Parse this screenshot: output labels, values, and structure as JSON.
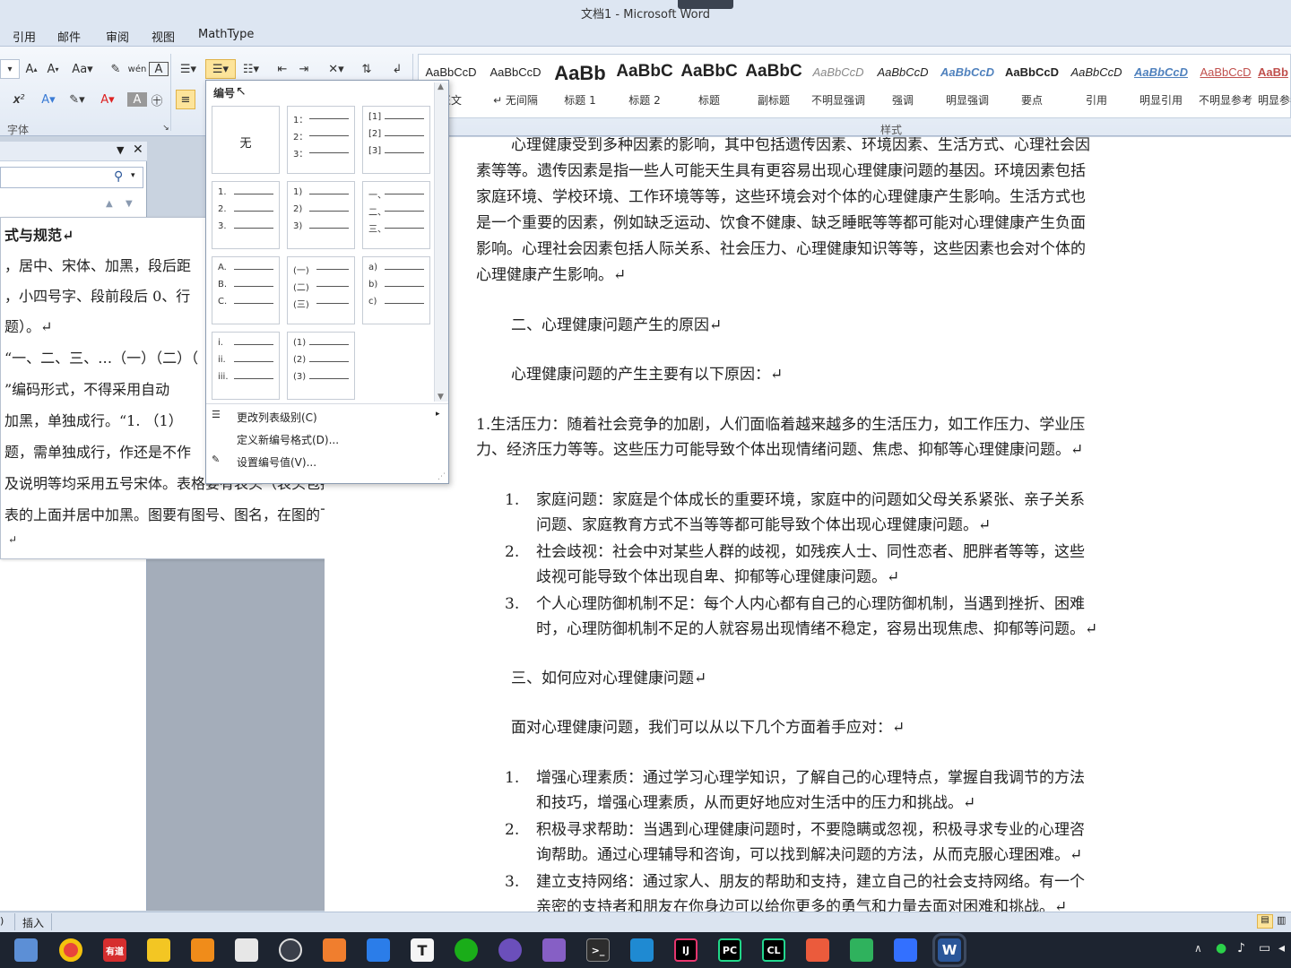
{
  "window": {
    "title": "文档1 - Microsoft Word"
  },
  "ribbon_tabs": [
    "引用",
    "邮件",
    "审阅",
    "视图",
    "MathType"
  ],
  "ribbon_groups": {
    "font": "字体",
    "styles": "样式"
  },
  "styles": [
    {
      "sample": "AaBbCcD",
      "name": "正文"
    },
    {
      "sample": "AaBbCcD",
      "name": "↵ 无间隔"
    },
    {
      "sample": "AaBb",
      "name": "标题 1"
    },
    {
      "sample": "AaBbC",
      "name": "标题 2"
    },
    {
      "sample": "AaBbC",
      "name": "标题"
    },
    {
      "sample": "AaBbC",
      "name": "副标题"
    },
    {
      "sample": "AaBbCcD",
      "name": "不明显强调"
    },
    {
      "sample": "AaBbCcD",
      "name": "强调"
    },
    {
      "sample": "AaBbCcD",
      "name": "明显强调"
    },
    {
      "sample": "AaBbCcD",
      "name": "要点"
    },
    {
      "sample": "AaBbCcD",
      "name": "引用"
    },
    {
      "sample": "AaBbCcD",
      "name": "明显引用"
    },
    {
      "sample": "AaBbCcD",
      "name": "不明显参考"
    },
    {
      "sample": "AaBb",
      "name": "明显参考"
    }
  ],
  "numbering_menu": {
    "title": "编号",
    "none_label": "无",
    "formats": [
      [
        "1：",
        "2：",
        "3："
      ],
      [
        "[1]",
        "[2]",
        "[3]"
      ],
      [
        "1.",
        "2.",
        "3."
      ],
      [
        "1)",
        "2)",
        "3)"
      ],
      [
        "一、",
        "二、",
        "三、"
      ],
      [
        "A.",
        "B.",
        "C."
      ],
      [
        "(一)",
        "(二)",
        "(三)"
      ],
      [
        "a)",
        "b)",
        "c)"
      ],
      [
        "i.",
        "ii.",
        "iii."
      ],
      [
        "(1)",
        "(2)",
        "(3)"
      ]
    ],
    "items": [
      "更改列表级别(C)",
      "定义新编号格式(D)...",
      "设置编号值(V)..."
    ]
  },
  "side_doc": {
    "lines": [
      "式与规范↵",
      "，居中、宋体、加黑，段后距",
      "，小四号字、段前段后 0、行",
      "题）。↵",
      "“一、二、三、…（一）（二）（",
      "”编码形式，不得采用自动",
      "加黑，单独成行。“1. （1）",
      "题，需单独成行，作还是不作",
      "及说明等均采用五号宋体。表格要有表头（表头包括",
      "表的上面并居中加黑。图要有图号、图名，在图的下",
      "↵"
    ]
  },
  "document": {
    "para1": [
      "心理健康受到多种因素的影响，其中包括遗传因素、环境因素、生活方式、心理社会因",
      "素等等。遗传因素是指一些人可能天生具有更容易出现心理健康问题的基因。环境因素包括",
      "家庭环境、学校环境、工作环境等等，这些环境会对个体的心理健康产生影响。生活方式也",
      "是一个重要的因素，例如缺乏运动、饮食不健康、缺乏睡眠等等都可能对心理健康产生负面",
      "影响。心理社会因素包括人际关系、社会压力、心理健康知识等等，这些因素也会对个体的",
      "心理健康产生影响。↵"
    ],
    "heading2": "二、心理健康问题产生的原因↵",
    "intro2": "心理健康问题的产生主要有以下原因：↵",
    "item1": [
      "1.生活压力：随着社会竞争的加剧，人们面临着越来越多的生活压力，如工作压力、学业压",
      "力、经济压力等等。这些压力可能导致个体出现情绪问题、焦虑、抑郁等心理健康问题。↵"
    ],
    "list1": [
      {
        "num": "1.",
        "lines": [
          "家庭问题：家庭是个体成长的重要环境，家庭中的问题如父母关系紧张、亲子关系",
          "问题、家庭教育方式不当等等都可能导致个体出现心理健康问题。↵"
        ]
      },
      {
        "num": "2.",
        "lines": [
          "社会歧视：社会中对某些人群的歧视，如残疾人士、同性恋者、肥胖者等等，这些",
          "歧视可能导致个体出现自卑、抑郁等心理健康问题。↵"
        ]
      },
      {
        "num": "3.",
        "lines": [
          "个人心理防御机制不足：每个人内心都有自己的心理防御机制，当遇到挫折、困难",
          "时，心理防御机制不足的人就容易出现情绪不稳定，容易出现焦虑、抑郁等问题。↵"
        ]
      }
    ],
    "heading3": "三、如何应对心理健康问题↵",
    "intro3": "面对心理健康问题，我们可以从以下几个方面着手应对：↵",
    "list2": [
      {
        "num": "1.",
        "lines": [
          "增强心理素质：通过学习心理学知识，了解自己的心理特点，掌握自我调节的方法",
          "和技巧，增强心理素质，从而更好地应对生活中的压力和挑战。↵"
        ]
      },
      {
        "num": "2.",
        "lines": [
          "积极寻求帮助：当遇到心理健康问题时，不要隐瞒或忽视，积极寻求专业的心理咨",
          "询帮助。通过心理辅导和咨询，可以找到解决问题的方法，从而克服心理困难。↵"
        ]
      },
      {
        "num": "3.",
        "lines": [
          "建立支持网络：通过家人、朋友的帮助和支持，建立自己的社会支持网络。有一个",
          "亲密的支持者和朋友在你身边可以给你更多的勇气和力量去面对困难和挑战。↵"
        ]
      }
    ]
  },
  "statusbar": {
    "mode": "插入"
  },
  "taskbar": {
    "apps": [
      {
        "icon": "file-explorer-icon",
        "label": "",
        "color": "#5c8fd6"
      },
      {
        "icon": "chrome-icon",
        "label": "",
        "color": "#e8453c"
      },
      {
        "icon": "youdao-icon",
        "label": "有道",
        "color": "#d62e2e"
      },
      {
        "icon": "sticky-notes-icon",
        "label": "",
        "color": "#f3c623"
      },
      {
        "icon": "photos-icon",
        "label": "",
        "color": "#f08c1a"
      },
      {
        "icon": "file-converter-icon",
        "label": "",
        "color": "#e7e7e7"
      },
      {
        "icon": "obs-icon",
        "label": "",
        "color": "#3a3f4a"
      },
      {
        "icon": "archive-icon",
        "label": "",
        "color": "#f07e2e"
      },
      {
        "icon": "todo-icon",
        "label": "",
        "color": "#2b7de9"
      },
      {
        "icon": "typora-icon",
        "label": "T",
        "color": "#f5f5f5"
      },
      {
        "icon": "wechat-dev-icon",
        "label": "",
        "color": "#1aad19"
      },
      {
        "icon": "github-icon",
        "label": "",
        "color": "#6b4fbb"
      },
      {
        "icon": "vs-icon",
        "label": "",
        "color": "#865fc5"
      },
      {
        "icon": "terminal-icon",
        "label": ">_",
        "color": "#2d2d2d"
      },
      {
        "icon": "vscode-icon",
        "label": "",
        "color": "#1f8ad2"
      },
      {
        "icon": "intellij-icon",
        "label": "IJ",
        "color": "#e8356d"
      },
      {
        "icon": "pycharm-icon",
        "label": "PC",
        "color": "#21d789"
      },
      {
        "icon": "clion-icon",
        "label": "CL",
        "color": "#22d88f"
      },
      {
        "icon": "office-icon",
        "label": "",
        "color": "#eb5b3c"
      },
      {
        "icon": "wps-icon",
        "label": "",
        "color": "#2fb25d"
      },
      {
        "icon": "feishu-icon",
        "label": "",
        "color": "#3370ff"
      },
      {
        "icon": "word-icon",
        "label": "W",
        "color": "#2b579a"
      }
    ]
  }
}
